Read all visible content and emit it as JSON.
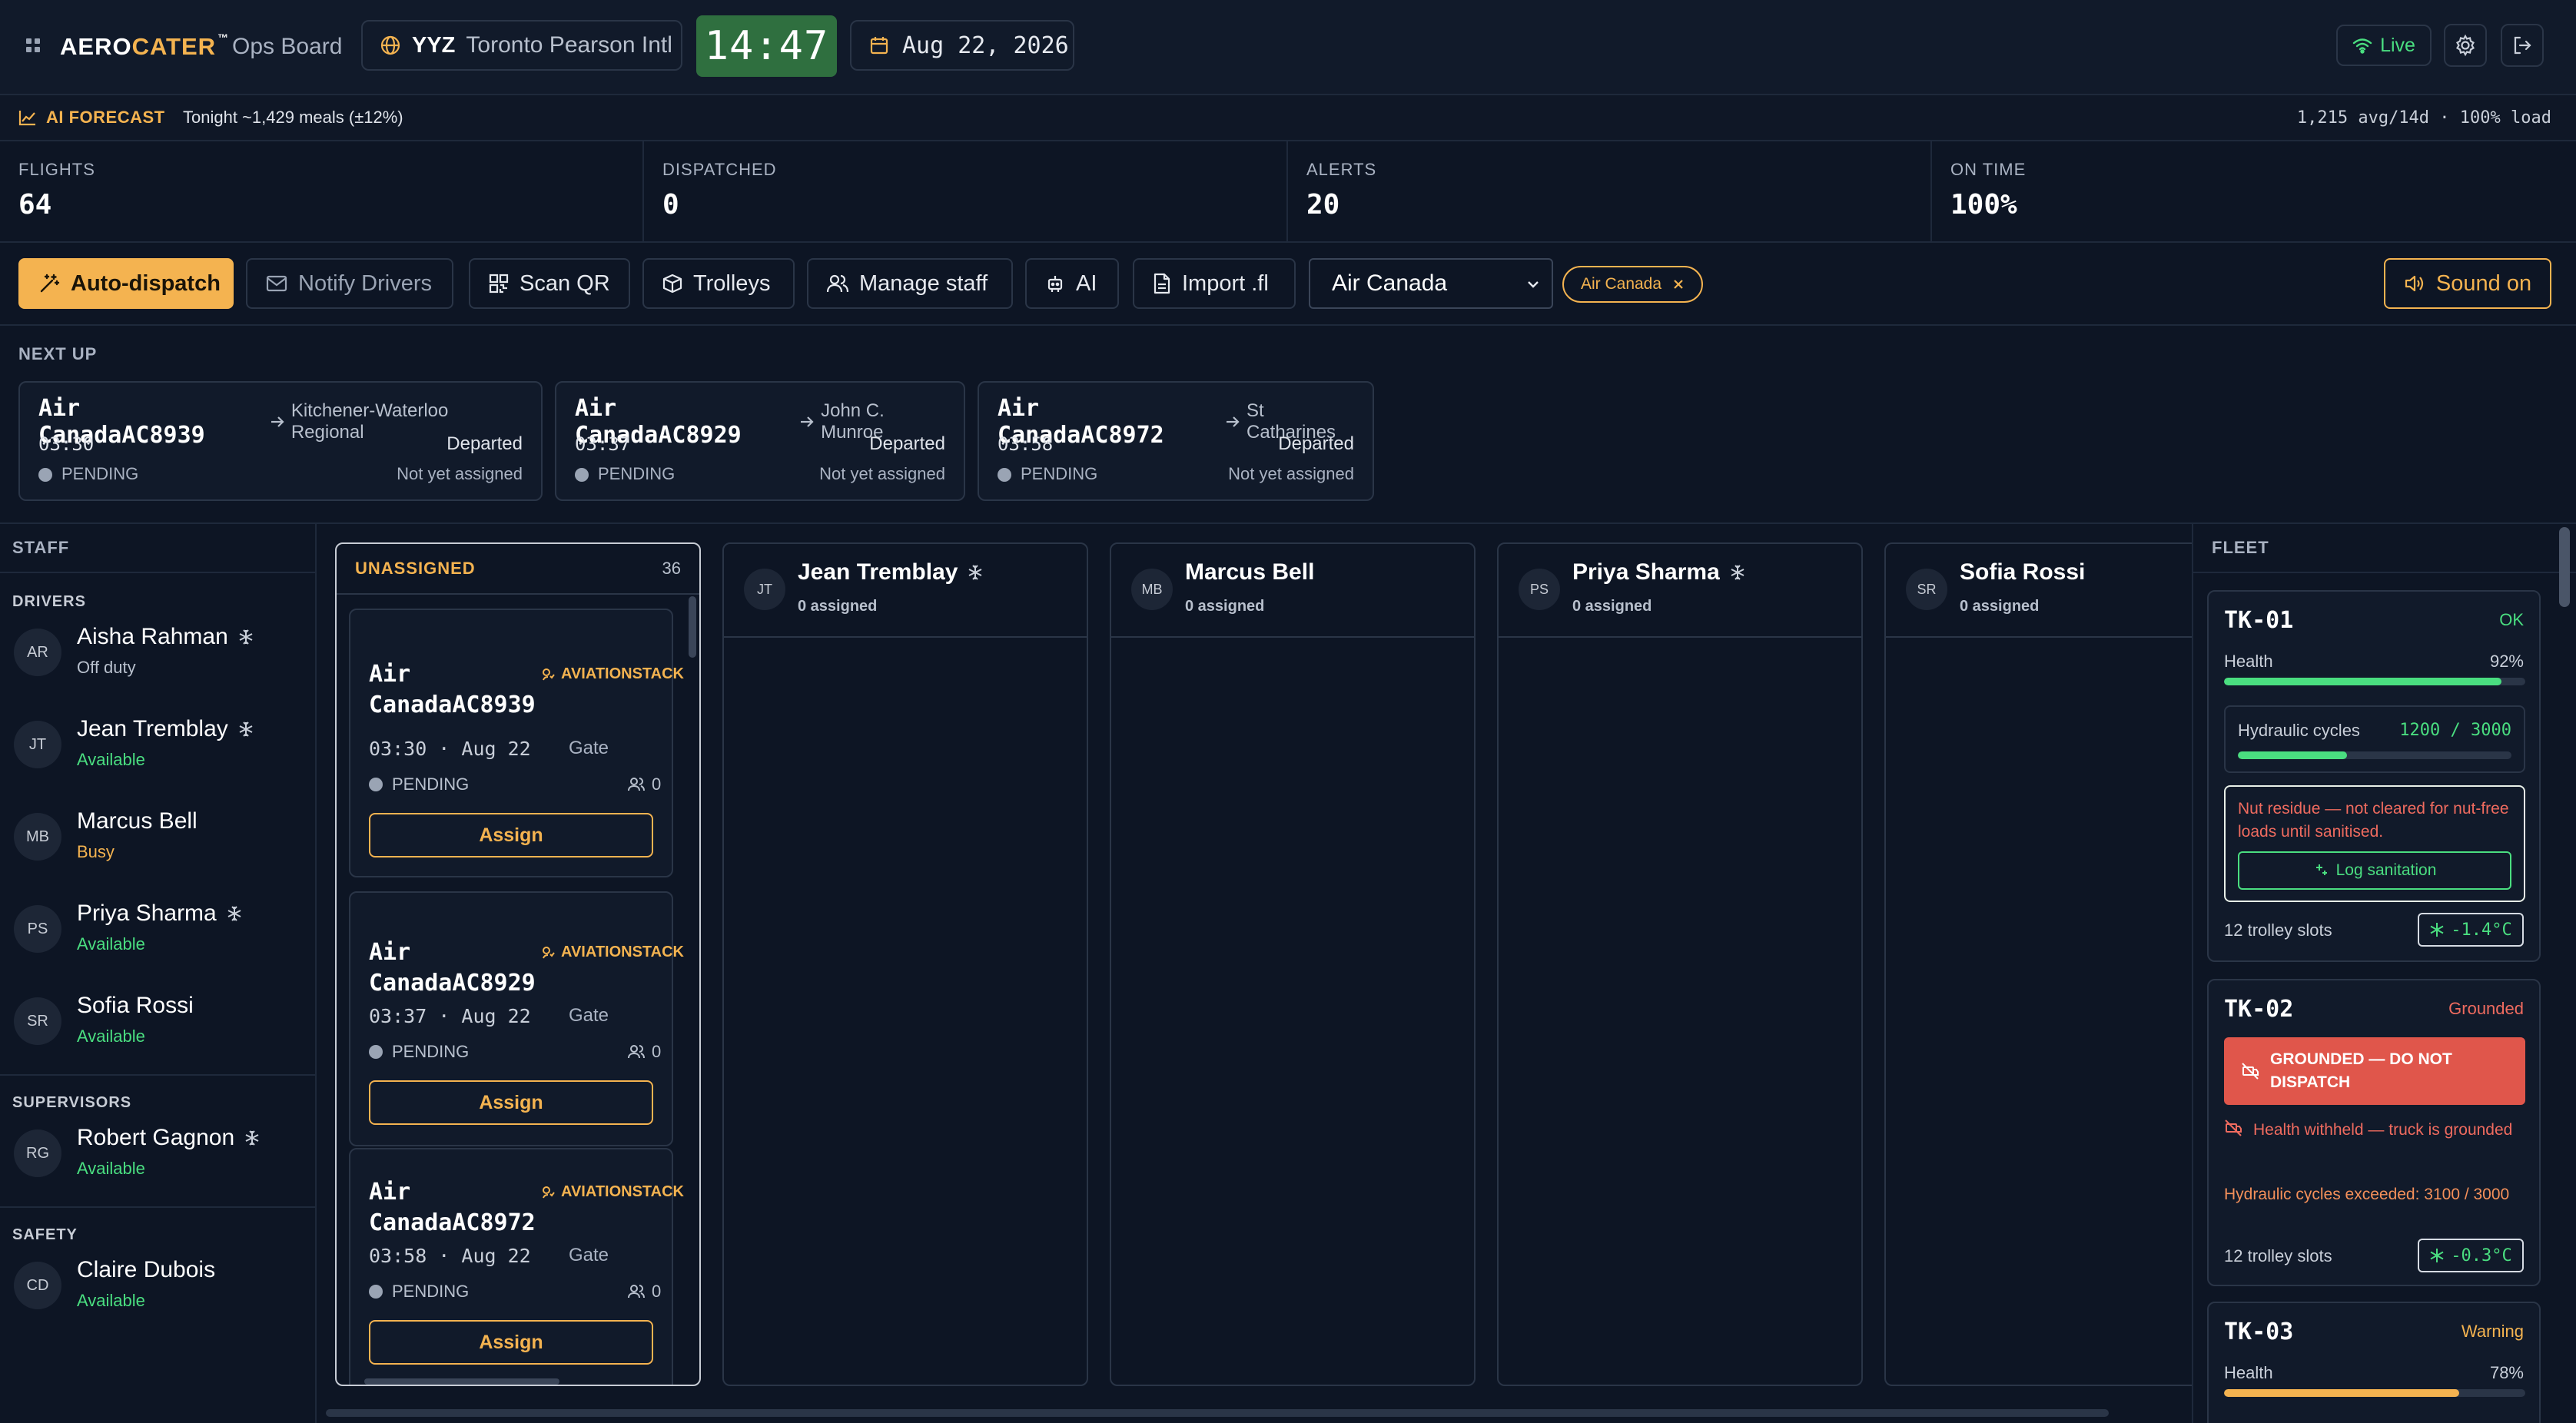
{
  "header": {
    "brand_prefix": "AERO",
    "brand_accent": "CATER",
    "brand_tm": "™",
    "subtitle": "Ops Board",
    "airport_code": "YYZ",
    "airport_name": "Toronto Pearson Intl",
    "clock": "14:47",
    "date": "Aug 22, 2026",
    "live_label": "Live"
  },
  "forecast": {
    "label": "AI FORECAST",
    "text": "Tonight ~1,429 meals (±12%)",
    "right": "1,215 avg/14d · 100% load"
  },
  "stats": [
    {
      "label": "FLIGHTS",
      "value": "64"
    },
    {
      "label": "DISPATCHED",
      "value": "0"
    },
    {
      "label": "ALERTS",
      "value": "20"
    },
    {
      "label": "ON TIME",
      "value": "100%"
    }
  ],
  "toolbar": {
    "auto_dispatch": "Auto-dispatch",
    "notify": "Notify Drivers",
    "scan": "Scan QR",
    "trolleys": "Trolleys",
    "manage": "Manage staff",
    "ai": "AI",
    "import": "Import .fl",
    "airline_select": "Air Canada",
    "filter_chip": "Air Canada",
    "sound": "Sound on"
  },
  "next_up": {
    "title": "NEXT UP",
    "cards": [
      {
        "flight": "Air CanadaAC8939",
        "dest": "Kitchener-Waterloo Regional",
        "time": "03:30",
        "state": "Departed",
        "status": "PENDING",
        "assignee": "Not yet assigned"
      },
      {
        "flight": "Air CanadaAC8929",
        "dest": "John C. Munroe",
        "time": "03:37",
        "state": "Departed",
        "status": "PENDING",
        "assignee": "Not yet assigned"
      },
      {
        "flight": "Air CanadaAC8972",
        "dest": "St Catharines",
        "time": "03:58",
        "state": "Departed",
        "status": "PENDING",
        "assignee": "Not yet assigned"
      }
    ]
  },
  "staff": {
    "title": "STAFF",
    "drivers_label": "DRIVERS",
    "supervisors_label": "SUPERVISORS",
    "safety_label": "SAFETY",
    "drivers": [
      {
        "initials": "AR",
        "name": "Aisha Rahman",
        "status": "Off duty",
        "badge": true
      },
      {
        "initials": "JT",
        "name": "Jean Tremblay",
        "status": "Available",
        "badge": true
      },
      {
        "initials": "MB",
        "name": "Marcus Bell",
        "status": "Busy",
        "badge": false
      },
      {
        "initials": "PS",
        "name": "Priya Sharma",
        "status": "Available",
        "badge": true
      },
      {
        "initials": "SR",
        "name": "Sofia Rossi",
        "status": "Available",
        "badge": false
      }
    ],
    "supervisors": [
      {
        "initials": "RG",
        "name": "Robert Gagnon",
        "status": "Available",
        "badge": true
      }
    ],
    "safety": [
      {
        "initials": "CD",
        "name": "Claire Dubois",
        "status": "Available",
        "badge": false
      }
    ]
  },
  "board": {
    "unassigned_title": "UNASSIGNED",
    "unassigned_count": "36",
    "flights": [
      {
        "line1": "Air",
        "line2": "CanadaAC8939",
        "tag": "AVIATIONSTACK",
        "time": "03:30 · Aug 22",
        "gate": "Gate",
        "status": "PENDING",
        "crew": "0",
        "button": "Assign"
      },
      {
        "line1": "Air",
        "line2": "CanadaAC8929",
        "tag": "AVIATIONSTACK",
        "time": "03:37 · Aug 22",
        "gate": "Gate",
        "status": "PENDING",
        "crew": "0",
        "button": "Assign"
      },
      {
        "line1": "Air",
        "line2": "CanadaAC8972",
        "tag": "AVIATIONSTACK",
        "time": "03:58 · Aug 22",
        "gate": "Gate",
        "status": "PENDING",
        "crew": "0",
        "button": "Assign"
      }
    ],
    "drivers": [
      {
        "initials": "JT",
        "name": "Jean Tremblay",
        "assigned": "0 assigned",
        "badge": true
      },
      {
        "initials": "MB",
        "name": "Marcus Bell",
        "assigned": "0 assigned",
        "badge": false
      },
      {
        "initials": "PS",
        "name": "Priya Sharma",
        "assigned": "0 assigned",
        "badge": true
      },
      {
        "initials": "SR",
        "name": "Sofia Rossi",
        "assigned": "0 assigned",
        "badge": false
      }
    ]
  },
  "fleet": {
    "title": "FLEET",
    "trucks": [
      {
        "id": "TK-01",
        "state": "OK",
        "health_label": "Health",
        "health": "92%",
        "health_value": 0.92,
        "hyd_label": "Hydraulic cycles",
        "hyd_value": "1200 / 3000",
        "hyd_ratio": 0.4,
        "warning": "Nut residue — not cleared for nut-free loads until sanitised.",
        "log_button": "Log sanitation",
        "slots": "12 trolley slots",
        "temp": "-1.4°C"
      },
      {
        "id": "TK-02",
        "state": "Grounded",
        "banner": "GROUNDED — DO NOT DISPATCH",
        "note1": "Health withheld — truck is grounded",
        "note2": "Hydraulic cycles exceeded: 3100 / 3000",
        "slots": "12 trolley slots",
        "temp": "-0.3°C"
      },
      {
        "id": "TK-03",
        "state": "Warning",
        "health_label": "Health",
        "health": "78%",
        "health_value": 0.78
      }
    ]
  },
  "colors": {
    "accent": "#f4b350",
    "ok": "#4ade80",
    "danger": "#ef6b5f",
    "clock_bg": "#2f6f3f"
  }
}
